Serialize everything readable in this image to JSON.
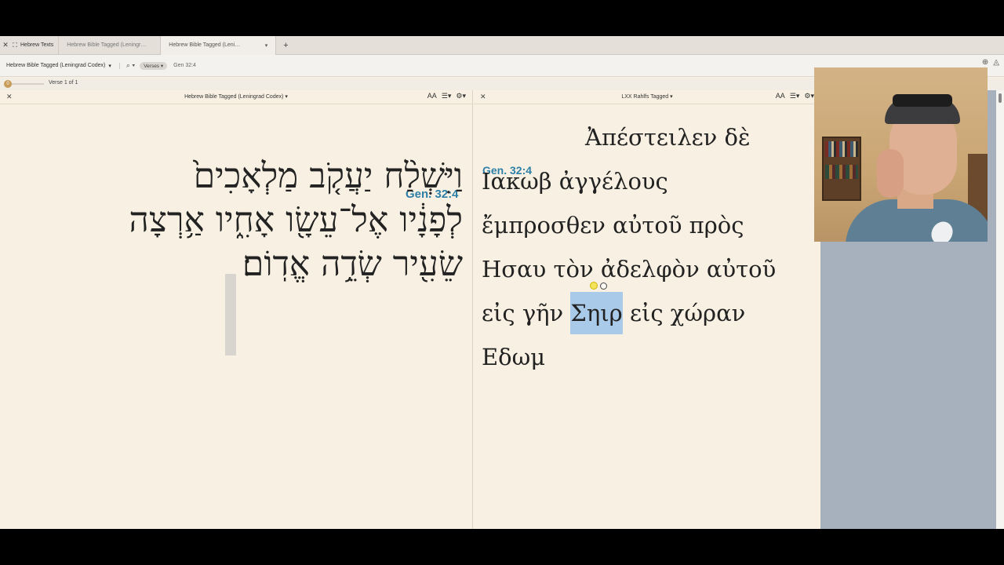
{
  "tabs": {
    "group_label": "Hebrew Texts",
    "items": [
      {
        "label": "Hebrew Bible Tagged (Leningr…"
      },
      {
        "label": "Hebrew Bible Tagged (Leni…"
      }
    ],
    "add_label": "+"
  },
  "toolbar": {
    "resource": "Hebrew Bible Tagged (Leningrad Codex)",
    "mode": "Verses",
    "reference": "Gen 32:4"
  },
  "versebar": {
    "slider_value": "0",
    "count": "Verse 1 of 1"
  },
  "left_pane": {
    "title": "Hebrew Bible Tagged (Leningrad Codex)",
    "text_size_label": "AA",
    "verse_ref": "Gen. 32:4",
    "lines": [
      "וַיִּשְׁלַ֨ח יַעֲקֹ֤ב מַלְאָכִים֙",
      "לְפָנָ֔יו אֶל־עֵשָׂ֖ו אָחִ֑יו אַ֥רְצָה",
      "שֵׂעִ֖יר שְׂדֵ֥ה אֱדֽוֹם׃"
    ]
  },
  "right_pane": {
    "title": "LXX Rahlfs Tagged",
    "text_size_label": "AA",
    "verse_ref": "Gen. 32:4",
    "lines": [
      "Ἀπέστειλεν δὲ",
      "Ιακωβ ἀγγέλους",
      "ἔμπροσθεν αὐτοῦ πρὸς",
      "Ησαυ τὸν ἀδελφὸν αὐτοῦ"
    ],
    "line5_before": "εἰς γῆν ",
    "line5_highlight": "Σηιρ",
    "line5_after": " εἰς χώραν",
    "line6": "Εδωμ"
  },
  "colors": {
    "verse_ref": "#2d7fa8",
    "highlight": "#a9cbe9",
    "accent": "#c89b57"
  }
}
